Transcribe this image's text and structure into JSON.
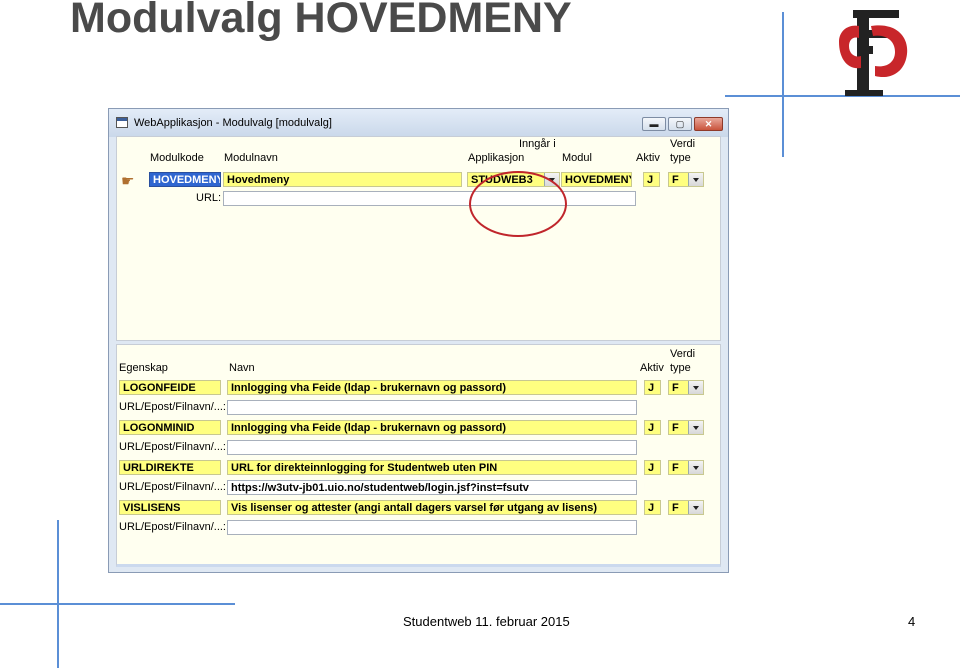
{
  "slide": {
    "title": "Modulvalg HOVEDMENY",
    "footer_center": "Studentweb 11. februar 2015",
    "page_number": "4",
    "accent_color": "#5b8fd6",
    "logo_icon": "fs-logo-icon"
  },
  "window": {
    "title": "WebApplikasjon - Modulvalg  [modulvalg]",
    "buttons": {
      "minimize": "▬",
      "maximize": "▢",
      "close": "✕"
    }
  },
  "module_section": {
    "headers": {
      "modulkode": "Modulkode",
      "modulnavn": "Modulnavn",
      "inngar_i": "Inngår i",
      "applikasjon": "Applikasjon",
      "modul": "Modul",
      "aktiv": "Aktiv",
      "verdi": "Verdi",
      "type": "type"
    },
    "row": {
      "modulkode": "HOVEDMENY",
      "modulnavn": "Hovedmeny",
      "applikasjon": "STUDWEB3",
      "modul": "HOVEDMENY",
      "aktiv": "J",
      "verdi_type": "F"
    },
    "url_label": "URL:",
    "url_value": ""
  },
  "property_section": {
    "headers": {
      "egenskap": "Egenskap",
      "navn": "Navn",
      "aktiv": "Aktiv",
      "verdi": "Verdi",
      "type": "type"
    },
    "url_label": "URL/Epost/Filnavn/...:",
    "rows": [
      {
        "egenskap": "LOGONFEIDE",
        "navn": "Innlogging vha Feide (ldap - brukernavn og passord)",
        "aktiv": "J",
        "type": "F",
        "url": ""
      },
      {
        "egenskap": "LOGONMINID",
        "navn": "Innlogging vha Feide (ldap - brukernavn og passord)",
        "aktiv": "J",
        "type": "F",
        "url": ""
      },
      {
        "egenskap": "URLDIREKTE",
        "navn": "URL for direkteinnlogging for Studentweb uten PIN",
        "aktiv": "J",
        "type": "F",
        "url": "https://w3utv-jb01.uio.no/studentweb/login.jsf?inst=fsutv"
      },
      {
        "egenskap": "VISLISENS",
        "navn": "Vis lisenser og attester (angi antall dagers varsel før utgang av lisens)",
        "aktiv": "J",
        "type": "F",
        "url": ""
      }
    ]
  }
}
